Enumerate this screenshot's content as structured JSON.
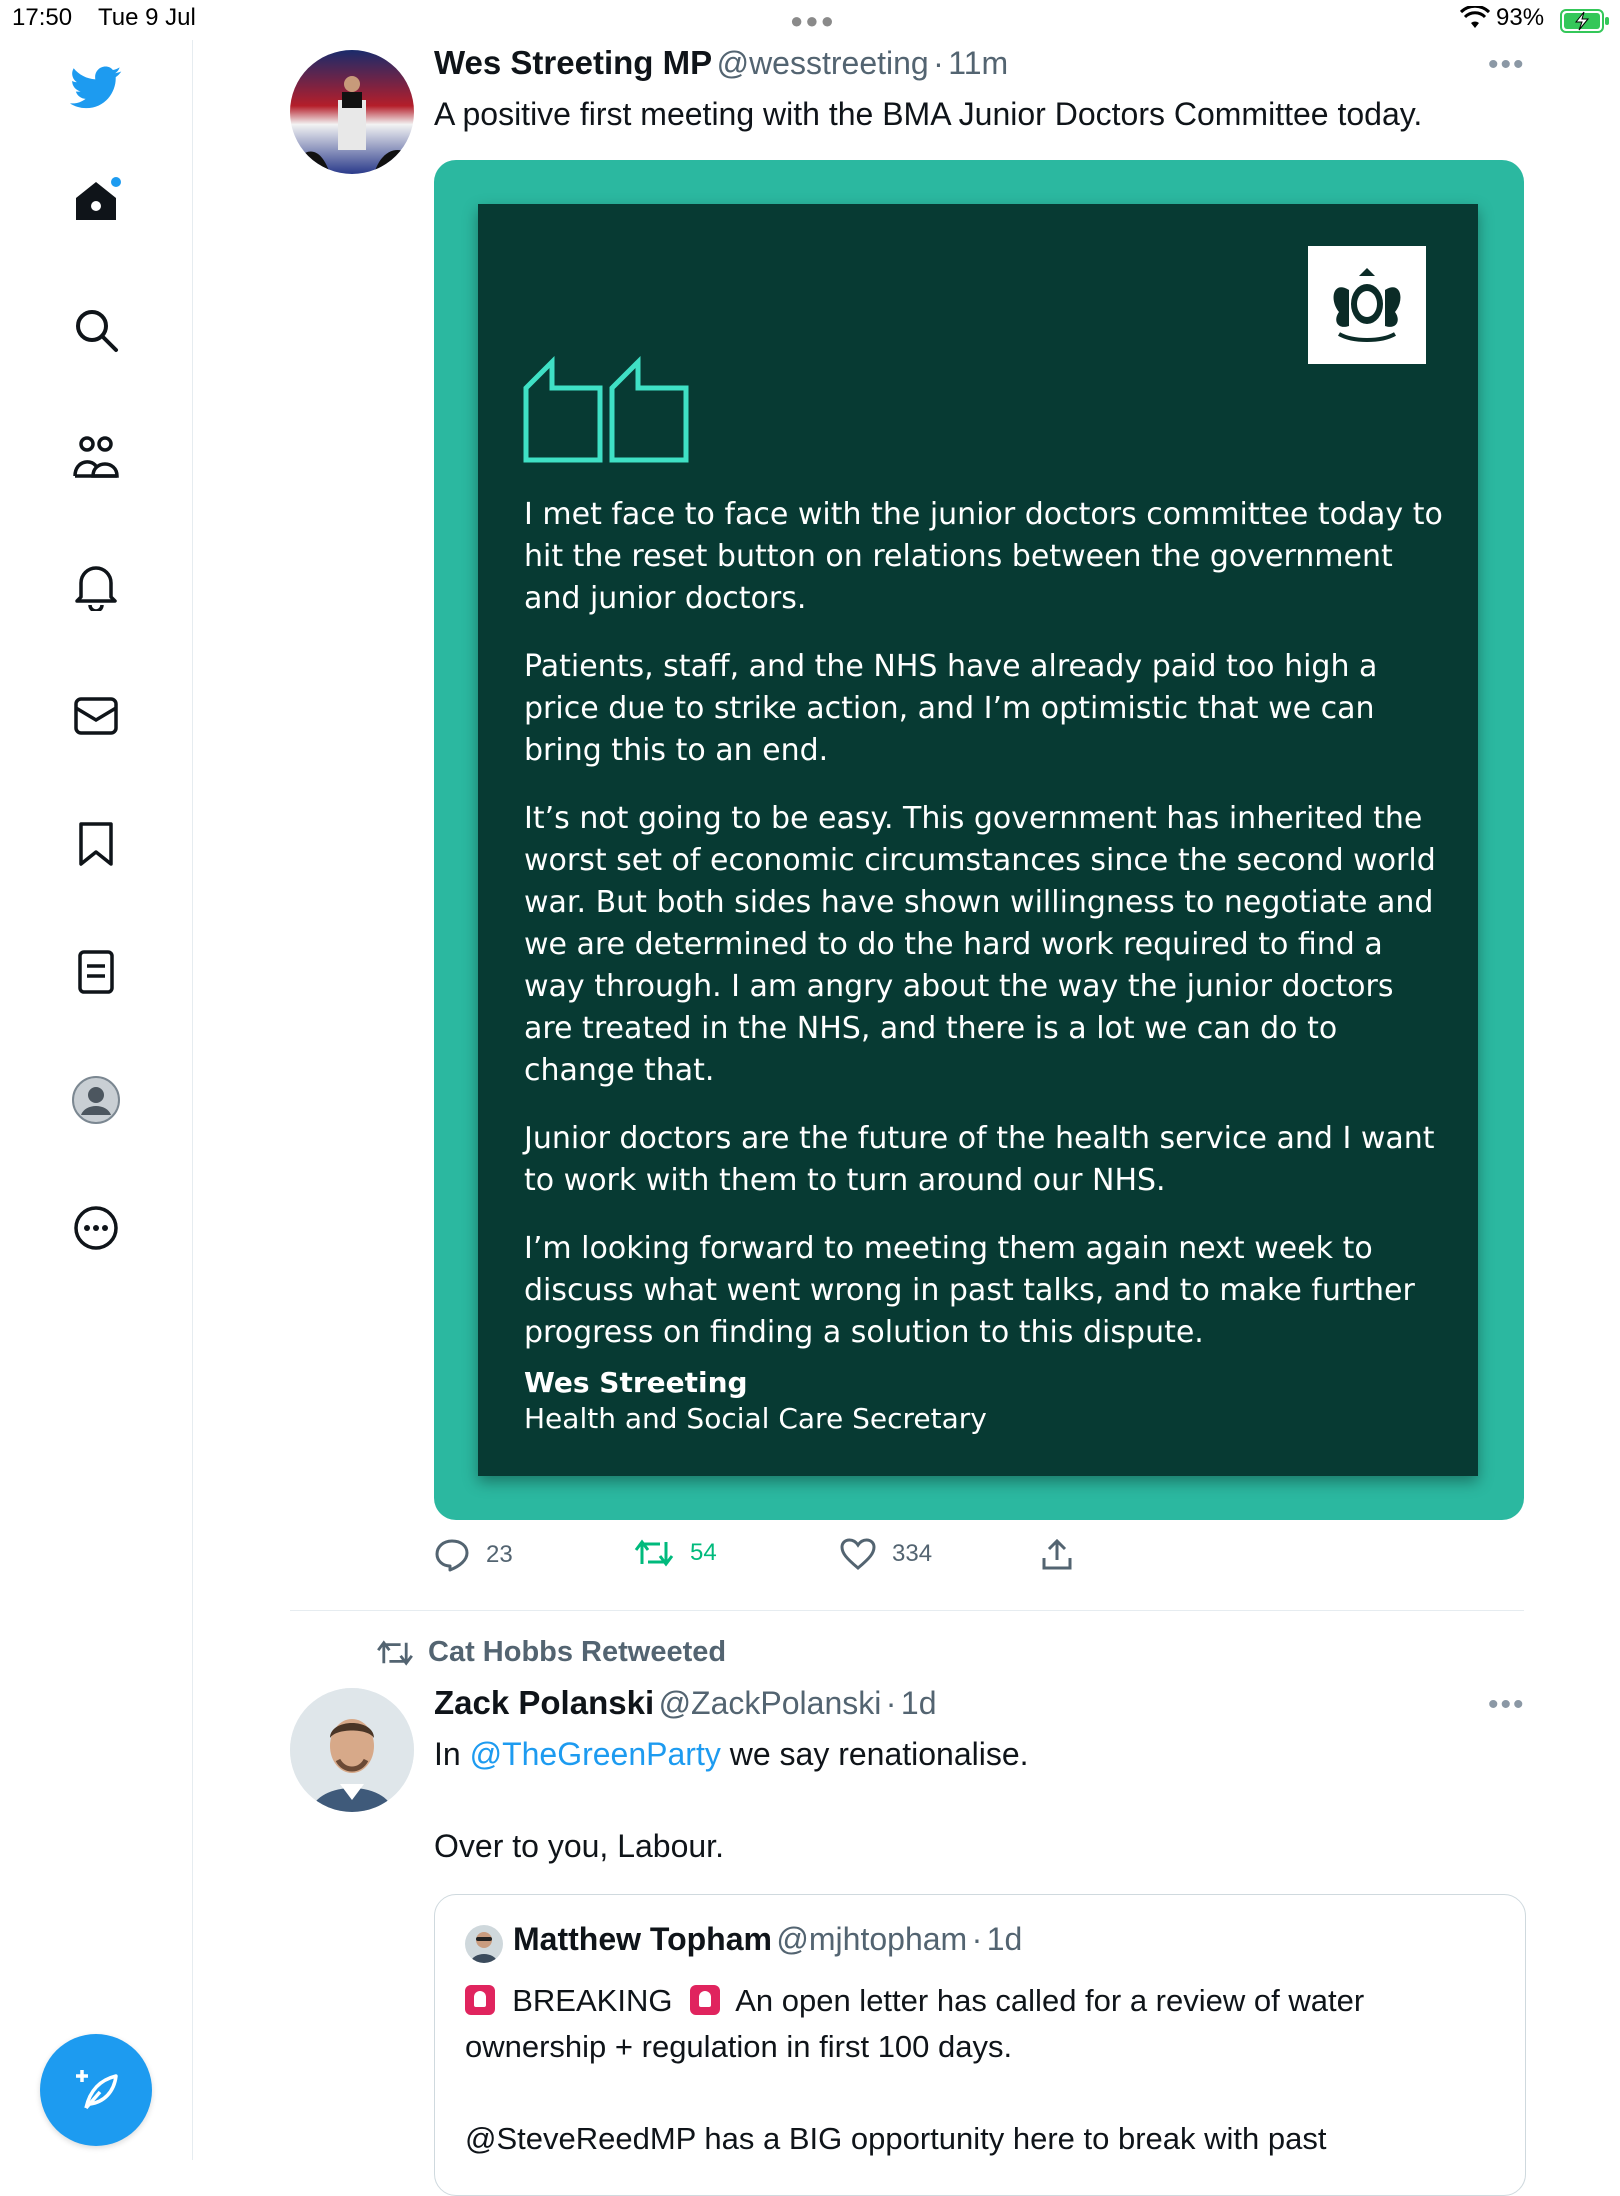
{
  "status_bar": {
    "time": "17:50",
    "date": "Tue 9 Jul",
    "battery_pct": "93%"
  },
  "sidebar": {
    "items": [
      {
        "icon": "twitter-bird-icon"
      },
      {
        "icon": "home-icon"
      },
      {
        "icon": "search-icon"
      },
      {
        "icon": "communities-icon"
      },
      {
        "icon": "notifications-bell-icon"
      },
      {
        "icon": "messages-envelope-icon"
      },
      {
        "icon": "bookmarks-icon"
      },
      {
        "icon": "lists-icon"
      },
      {
        "icon": "profile-avatar-icon"
      },
      {
        "icon": "more-circle-icon"
      }
    ],
    "compose_icon": "compose-feather-icon"
  },
  "tweet1": {
    "name": "Wes Streeting MP",
    "handle": "@wesstreeting",
    "sep": "·",
    "time": "11m",
    "text": "A positive first meeting with the BMA Junior Doctors Committee today.",
    "card": {
      "paragraphs": [
        "I met face to face with the junior doctors committee today to hit the reset button on relations between the government and junior doctors.",
        "Patients, staff, and the NHS have already paid too high a price due to strike action, and I’m optimistic that we can bring this to an end.",
        "It’s not going to be easy. This government has inherited the worst set of economic circumstances since the second world war. But both sides have shown willingness to negotiate and we are determined to do the hard work required to find a way through. I am angry about the way the junior doctors are treated in the NHS, and there is a lot we can do to change that.",
        "Junior doctors are the future of the health service and I want to work with them to turn around our NHS.",
        "I’m looking forward to meeting them again next week to discuss what went wrong in past talks, and to make further progress on finding a solution to this dispute."
      ],
      "signature_name": "Wes Streeting",
      "signature_role": "Health and Social Care Secretary"
    },
    "replies": "23",
    "retweets": "54",
    "likes": "334"
  },
  "tweet2": {
    "retweeted_by": "Cat Hobbs Retweeted",
    "name": "Zack Polanski",
    "handle": "@ZackPolanski",
    "sep": "·",
    "time": "1d",
    "text_prefix": "In ",
    "mention": "@TheGreenParty",
    "text_suffix": " we say renationalise.",
    "text2": "Over to you, Labour.",
    "quoted": {
      "name": "Matthew Topham",
      "handle": "@mjhtopham",
      "sep": "·",
      "time": "1d",
      "breaking": "BREAKING",
      "line1_rest": "An open letter has called for a review of water",
      "line2": "ownership + regulation in first 100 days.",
      "line3": "@SteveReedMP has a BIG opportunity here to break with past"
    }
  },
  "colors": {
    "accent": "#1d9bf0",
    "retweet_green": "#00ba7c",
    "card_bg": "#073a33",
    "card_frame": "#2bb8a0"
  }
}
